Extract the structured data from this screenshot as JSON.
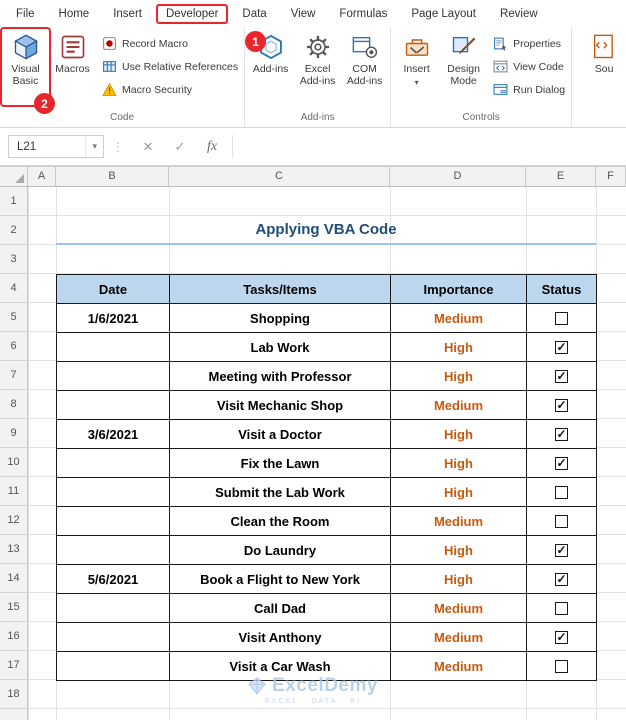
{
  "ribbon": {
    "tabs": [
      "File",
      "Home",
      "Insert",
      "Developer",
      "Data",
      "View",
      "Formulas",
      "Page Layout",
      "Review"
    ],
    "active_tab": "Developer",
    "code": {
      "group_label": "Code",
      "visual_basic": "Visual Basic",
      "macros": "Macros",
      "record_macro": "Record Macro",
      "use_relative_references": "Use Relative References",
      "macro_security": "Macro Security"
    },
    "addins": {
      "group_label": "Add-ins",
      "add_ins": "Add-ins",
      "excel_add_ins": "Excel Add-ins",
      "com_add_ins": "COM Add-ins"
    },
    "controls": {
      "group_label": "Controls",
      "insert": "Insert",
      "design_mode": "Design Mode",
      "properties": "Properties",
      "view_code": "View Code",
      "run_dialog": "Run Dialog"
    },
    "partial": {
      "source": "Sou"
    }
  },
  "annotations": {
    "step_1": "1",
    "step_2": "2"
  },
  "formula_bar": {
    "name_box": "L21"
  },
  "icons": {
    "dropdown": "▾",
    "separator_dots": "⋮",
    "cancel": "✕",
    "enter": "✓",
    "fx": "fx",
    "check": "✓"
  },
  "sheet": {
    "column_headers": [
      "A",
      "B",
      "C",
      "D",
      "E",
      "F"
    ],
    "row_numbers": [
      "1",
      "2",
      "3",
      "4",
      "5",
      "6",
      "7",
      "8",
      "9",
      "10",
      "11",
      "12",
      "13",
      "14",
      "15",
      "16",
      "17",
      "18"
    ],
    "title": "Applying VBA Code",
    "table": {
      "headers": [
        "Date",
        "Tasks/Items",
        "Importance",
        "Status"
      ],
      "rows": [
        {
          "date": "1/6/2021",
          "task": "Shopping",
          "importance": "Medium",
          "checked": false
        },
        {
          "date": "",
          "task": "Lab Work",
          "importance": "High",
          "checked": true
        },
        {
          "date": "",
          "task": "Meeting with Professor",
          "importance": "High",
          "checked": true
        },
        {
          "date": "",
          "task": "Visit Mechanic Shop",
          "importance": "Medium",
          "checked": true
        },
        {
          "date": "3/6/2021",
          "task": "Visit a Doctor",
          "importance": "High",
          "checked": true
        },
        {
          "date": "",
          "task": "Fix the Lawn",
          "importance": "High",
          "checked": true
        },
        {
          "date": "",
          "task": "Submit the Lab Work",
          "importance": "High",
          "checked": false
        },
        {
          "date": "",
          "task": "Clean the Room",
          "importance": "Medium",
          "checked": false
        },
        {
          "date": "",
          "task": "Do Laundry",
          "importance": "High",
          "checked": true
        },
        {
          "date": "5/6/2021",
          "task": "Book a Flight to New York",
          "importance": "High",
          "checked": true
        },
        {
          "date": "",
          "task": "Call Dad",
          "importance": "Medium",
          "checked": false
        },
        {
          "date": "",
          "task": "Visit Anthony",
          "importance": "Medium",
          "checked": true
        },
        {
          "date": "",
          "task": "Visit a Car Wash",
          "importance": "Medium",
          "checked": false
        }
      ]
    }
  },
  "watermark": {
    "brand": "ExcelDemy",
    "tagline": "EXCEL · DATA · BI"
  },
  "colors": {
    "annotation_red": "#E8262C",
    "title_blue": "#1F4E79",
    "table_header_fill": "#BDD7EE",
    "importance_orange": "#C55A11",
    "title_underline": "#9DC3E6"
  }
}
